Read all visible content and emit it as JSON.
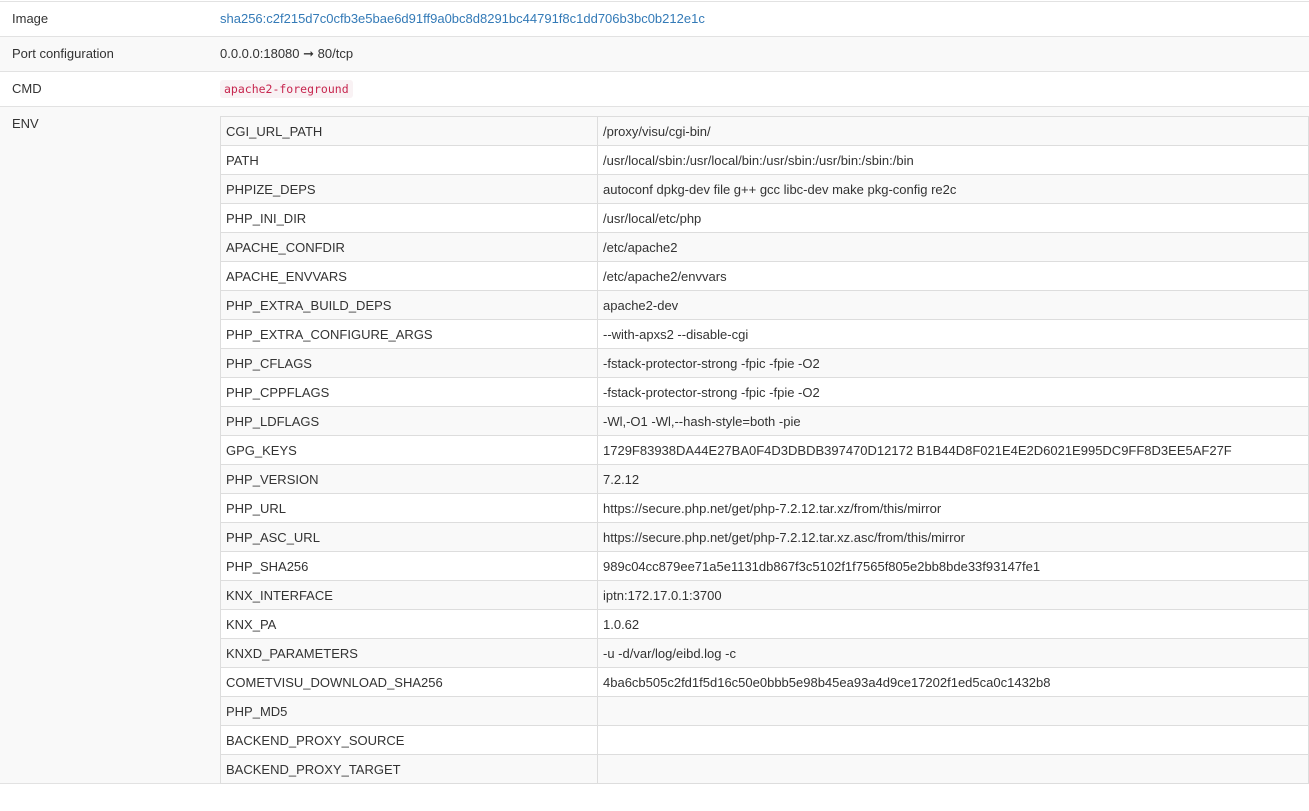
{
  "details": {
    "image": {
      "label": "Image",
      "value": "sha256:c2f215d7c0cfb3e5bae6d91ff9a0bc8d8291bc44791f8c1dd706b3bc0b212e1c"
    },
    "ports": {
      "label": "Port configuration",
      "value": "0.0.0.0:18080 ➞ 80/tcp"
    },
    "cmd": {
      "label": "CMD",
      "value": "apache2-foreground"
    },
    "env": {
      "label": "ENV",
      "items": [
        {
          "key": "CGI_URL_PATH",
          "value": "/proxy/visu/cgi-bin/"
        },
        {
          "key": "PATH",
          "value": "/usr/local/sbin:/usr/local/bin:/usr/sbin:/usr/bin:/sbin:/bin"
        },
        {
          "key": "PHPIZE_DEPS",
          "value": "autoconf dpkg-dev file g++ gcc libc-dev make pkg-config re2c"
        },
        {
          "key": "PHP_INI_DIR",
          "value": "/usr/local/etc/php"
        },
        {
          "key": "APACHE_CONFDIR",
          "value": "/etc/apache2"
        },
        {
          "key": "APACHE_ENVVARS",
          "value": "/etc/apache2/envvars"
        },
        {
          "key": "PHP_EXTRA_BUILD_DEPS",
          "value": "apache2-dev"
        },
        {
          "key": "PHP_EXTRA_CONFIGURE_ARGS",
          "value": "--with-apxs2 --disable-cgi"
        },
        {
          "key": "PHP_CFLAGS",
          "value": "-fstack-protector-strong -fpic -fpie -O2"
        },
        {
          "key": "PHP_CPPFLAGS",
          "value": "-fstack-protector-strong -fpic -fpie -O2"
        },
        {
          "key": "PHP_LDFLAGS",
          "value": "-Wl,-O1 -Wl,--hash-style=both -pie"
        },
        {
          "key": "GPG_KEYS",
          "value": "1729F83938DA44E27BA0F4D3DBDB397470D12172 B1B44D8F021E4E2D6021E995DC9FF8D3EE5AF27F"
        },
        {
          "key": "PHP_VERSION",
          "value": "7.2.12"
        },
        {
          "key": "PHP_URL",
          "value": "https://secure.php.net/get/php-7.2.12.tar.xz/from/this/mirror"
        },
        {
          "key": "PHP_ASC_URL",
          "value": "https://secure.php.net/get/php-7.2.12.tar.xz.asc/from/this/mirror"
        },
        {
          "key": "PHP_SHA256",
          "value": "989c04cc879ee71a5e1131db867f3c5102f1f7565f805e2bb8bde33f93147fe1"
        },
        {
          "key": "KNX_INTERFACE",
          "value": "iptn:172.17.0.1:3700"
        },
        {
          "key": "KNX_PA",
          "value": "1.0.62"
        },
        {
          "key": "KNXD_PARAMETERS",
          "value": "-u -d/var/log/eibd.log -c"
        },
        {
          "key": "COMETVISU_DOWNLOAD_SHA256",
          "value": "4ba6cb505c2fd1f5d16c50e0bbb5e98b45ea93a4d9ce17202f1ed5ca0c1432b8"
        },
        {
          "key": "PHP_MD5",
          "value": ""
        },
        {
          "key": "BACKEND_PROXY_SOURCE",
          "value": ""
        },
        {
          "key": "BACKEND_PROXY_TARGET",
          "value": ""
        }
      ]
    }
  }
}
